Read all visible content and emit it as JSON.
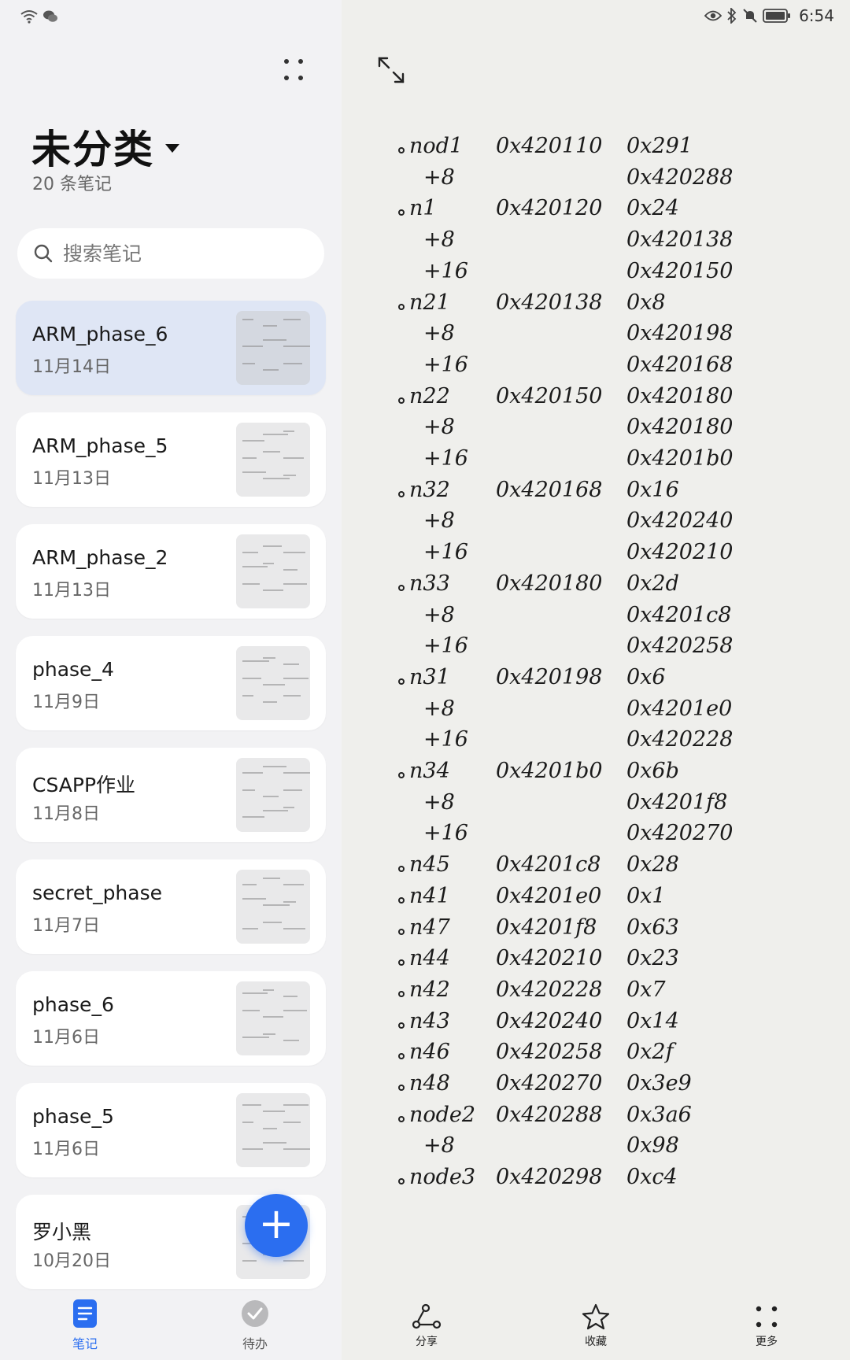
{
  "status": {
    "time": "6:54",
    "icons": [
      "wifi-icon",
      "wechat-icon",
      "eye-icon",
      "bluetooth-icon",
      "mute-icon",
      "battery-icon"
    ]
  },
  "sidebar": {
    "folder_title": "未分类",
    "note_count": "20 条笔记",
    "search_placeholder": "搜索笔记",
    "notes": [
      {
        "title": "ARM_phase_6",
        "date": "11月14日",
        "selected": true
      },
      {
        "title": "ARM_phase_5",
        "date": "11月13日"
      },
      {
        "title": "ARM_phase_2",
        "date": "11月13日"
      },
      {
        "title": "phase_4",
        "date": "11月9日"
      },
      {
        "title": "CSAPP作业",
        "date": "11月8日"
      },
      {
        "title": "secret_phase",
        "date": "11月7日"
      },
      {
        "title": "phase_6",
        "date": "11月6日"
      },
      {
        "title": "phase_5",
        "date": "11月6日"
      },
      {
        "title": "罗小黑",
        "date": "10月20日"
      }
    ],
    "tabs": [
      {
        "label": "笔记",
        "active": true
      },
      {
        "label": "待办",
        "active": false
      }
    ],
    "accent_color": "#2b6ef0"
  },
  "note_content": {
    "rows": [
      {
        "name": "nod1",
        "addr": "0x420110",
        "val": "0x291"
      },
      {
        "off": "+8",
        "val": "0x420288"
      },
      {
        "name": "n1",
        "addr": "0x420120",
        "val": "0x24"
      },
      {
        "off": "+8",
        "val": "0x420138"
      },
      {
        "off": "+16",
        "val": "0x420150"
      },
      {
        "name": "n21",
        "addr": "0x420138",
        "val": "0x8"
      },
      {
        "off": "+8",
        "val": "0x420198"
      },
      {
        "off": "+16",
        "val": "0x420168"
      },
      {
        "name": "n22",
        "addr": "0x420150",
        "val": "0x420180"
      },
      {
        "off": "+8",
        "val": "0x420180"
      },
      {
        "off": "+16",
        "val": "0x4201b0"
      },
      {
        "name": "n32",
        "addr": "0x420168",
        "val": "0x16"
      },
      {
        "off": "+8",
        "val": "0x420240"
      },
      {
        "off": "+16",
        "val": "0x420210"
      },
      {
        "name": "n33",
        "addr": "0x420180",
        "val": "0x2d"
      },
      {
        "off": "+8",
        "val": "0x4201c8"
      },
      {
        "off": "+16",
        "val": "0x420258"
      },
      {
        "name": "n31",
        "addr": "0x420198",
        "val": "0x6"
      },
      {
        "off": "+8",
        "val": "0x4201e0"
      },
      {
        "off": "+16",
        "val": "0x420228"
      },
      {
        "name": "n34",
        "addr": "0x4201b0",
        "val": "0x6b"
      },
      {
        "off": "+8",
        "val": "0x4201f8"
      },
      {
        "off": "+16",
        "val": "0x420270"
      },
      {
        "name": "n45",
        "addr": "0x4201c8",
        "val": "0x28"
      },
      {
        "name": "n41",
        "addr": "0x4201e0",
        "val": "0x1"
      },
      {
        "name": "n47",
        "addr": "0x4201f8",
        "val": "0x63"
      },
      {
        "name": "n44",
        "addr": "0x420210",
        "val": "0x23"
      },
      {
        "name": "n42",
        "addr": "0x420228",
        "val": "0x7"
      },
      {
        "name": "n43",
        "addr": "0x420240",
        "val": "0x14"
      },
      {
        "name": "n46",
        "addr": "0x420258",
        "val": "0x2f"
      },
      {
        "name": "n48",
        "addr": "0x420270",
        "val": "0x3e9"
      },
      {
        "name": "node2",
        "addr": "0x420288",
        "val": "0x3a6"
      },
      {
        "off": "+8",
        "val": "0x98"
      },
      {
        "name": "node3",
        "addr": "0x420298",
        "val": "0xc4"
      }
    ]
  },
  "actions": [
    {
      "label": "分享",
      "icon": "share-icon"
    },
    {
      "label": "收藏",
      "icon": "star-icon"
    },
    {
      "label": "更多",
      "icon": "more-icon"
    }
  ]
}
